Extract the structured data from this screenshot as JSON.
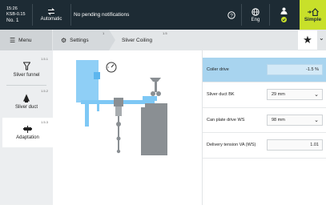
{
  "topbar": {
    "machine_line1": "15:26",
    "machine_line2": "KSB-0.15",
    "machine_no": "No. 1",
    "mode_label": "Automatic",
    "notifications": "No pending notifications",
    "language_label": "Eng",
    "simple_label": "Simple"
  },
  "breadcrumb": {
    "menu_label": "Menu",
    "settings_label": "Settings",
    "settings_num": "1",
    "current_label": "Sliver Coiling",
    "current_num": "1.5"
  },
  "sidebar": {
    "items": [
      {
        "label": "Sliver funnel",
        "num": "1.5.1",
        "icon": "funnel-icon"
      },
      {
        "label": "Sliver duct",
        "num": "1.5.2",
        "icon": "duct-icon"
      },
      {
        "label": "Adaptation",
        "num": "1.5.3",
        "icon": "adaptation-icon"
      }
    ]
  },
  "params": [
    {
      "label": "Coiler drive",
      "value": "-1.5 %",
      "type": "value",
      "selected": true
    },
    {
      "label": "Sliver duct BK",
      "value": "29 mm",
      "type": "dropdown"
    },
    {
      "label": "Can plate drive WS",
      "value": "98 mm",
      "type": "dropdown"
    },
    {
      "label": "Delivery tension VA (WS)",
      "value": "1.01",
      "type": "value"
    }
  ],
  "colors": {
    "accent_blue": "#7ec8f5",
    "selected_row": "#a8d4ef",
    "topbar": "#1d2b34",
    "simple_btn": "#c8e02a",
    "can_gray": "#8a8f93"
  }
}
